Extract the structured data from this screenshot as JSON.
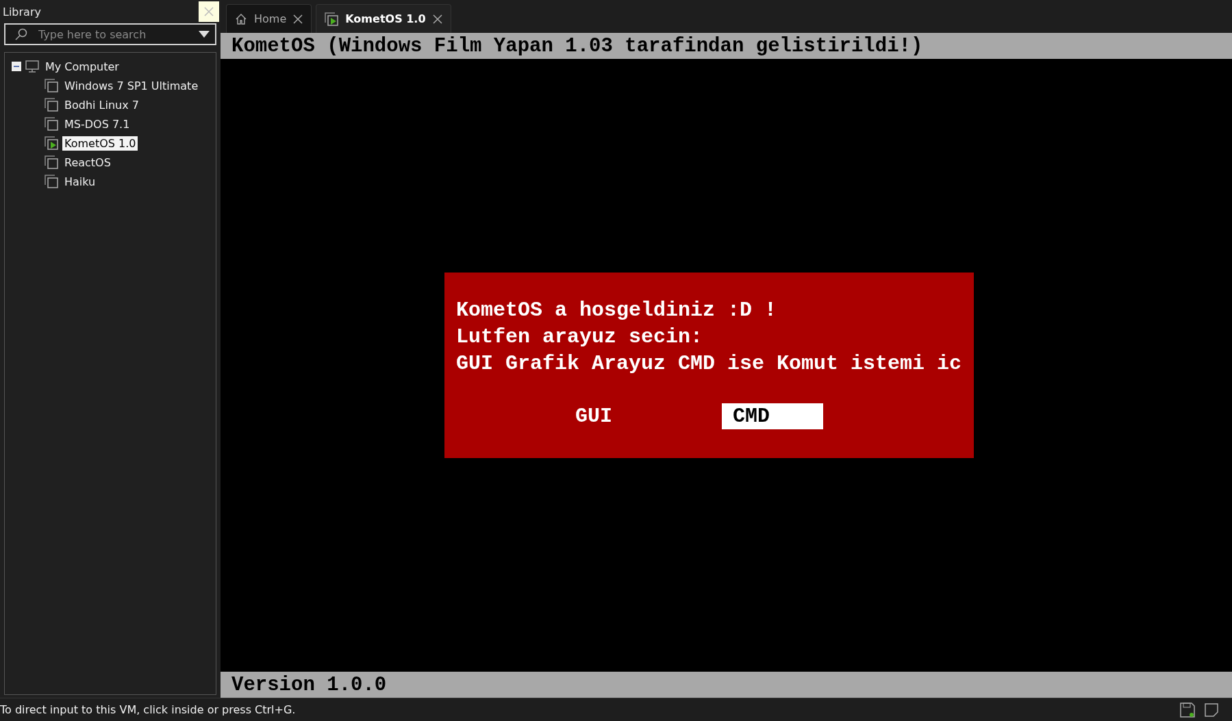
{
  "library": {
    "title": "Library",
    "search": {
      "placeholder": "Type here to search"
    },
    "tree": [
      {
        "label": "My Computer",
        "expanded": true,
        "children": [
          {
            "label": "Windows 7 SP1 Ultimate",
            "selected": false,
            "running": false
          },
          {
            "label": "Bodhi Linux 7",
            "selected": false,
            "running": false
          },
          {
            "label": "MS-DOS 7.1",
            "selected": false,
            "running": false
          },
          {
            "label": "KometOS 1.0",
            "selected": true,
            "running": true
          },
          {
            "label": "ReactOS",
            "selected": false,
            "running": false
          },
          {
            "label": "Haiku",
            "selected": false,
            "running": false
          }
        ]
      }
    ]
  },
  "tabs": [
    {
      "label": "Home",
      "kind": "home",
      "selected": false
    },
    {
      "label": "KometOS 1.0",
      "kind": "vm",
      "selected": true
    }
  ],
  "vm_screen": {
    "header": "KometOS (Windows Film Yapan 1.03 tarafindan gelistirildi!)",
    "dialog": {
      "lines": [
        "KometOS a hosgeldiniz :D !",
        "Lutfen arayuz secin:",
        "GUI Grafik Arayuz CMD ise Komut istemi ic"
      ],
      "options": [
        {
          "label": "GUI",
          "selected": false
        },
        {
          "label": "CMD",
          "selected": true
        }
      ]
    },
    "footer": "Version 1.0.0"
  },
  "status_bar": {
    "message": "To direct input to this VM, click inside or press Ctrl+G."
  }
}
